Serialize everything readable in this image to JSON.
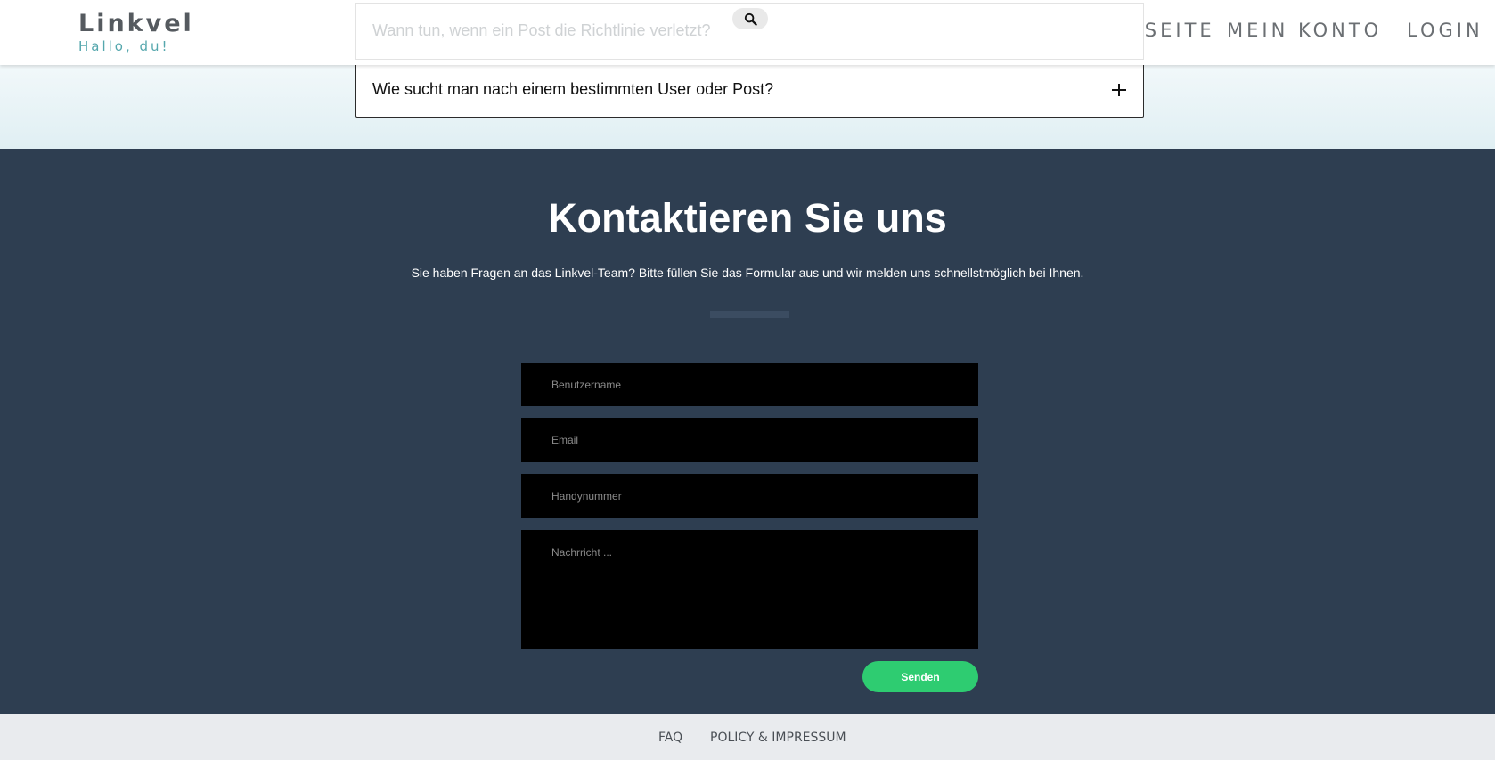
{
  "header": {
    "logo_title": "Linkvel",
    "logo_subtitle": "Hallo, du!",
    "nav": {
      "home": "STARTSEITE",
      "account": "MEIN KONTO",
      "login": "LOGIN"
    }
  },
  "faq": {
    "search_text": "Wann tun, wenn ein Post die Richtlinie verletzt?",
    "search_icon": "search-icon",
    "item_question": "Wie sucht man nach einem bestimmten User oder Post?",
    "expand_icon": "plus-icon"
  },
  "contact": {
    "title": "Kontaktieren Sie uns",
    "subtitle": "Sie haben Fragen an das Linkvel-Team? Bitte füllen Sie das Formular aus und wir melden uns schnellstmöglich bei Ihnen.",
    "username_placeholder": "Benutzername",
    "email_placeholder": "Email",
    "phone_placeholder": "Handynummer",
    "message_placeholder": "Nachrricht ...",
    "send_label": "Senden"
  },
  "footer": {
    "faq_label": "FAQ",
    "policy_label": "POLICY & IMPRESSUM"
  },
  "colors": {
    "contact_bg": "#2e3e51",
    "send_button": "#2ecc71",
    "logo_subtitle": "#55a7ad",
    "footer_bg": "#e9ebee"
  }
}
